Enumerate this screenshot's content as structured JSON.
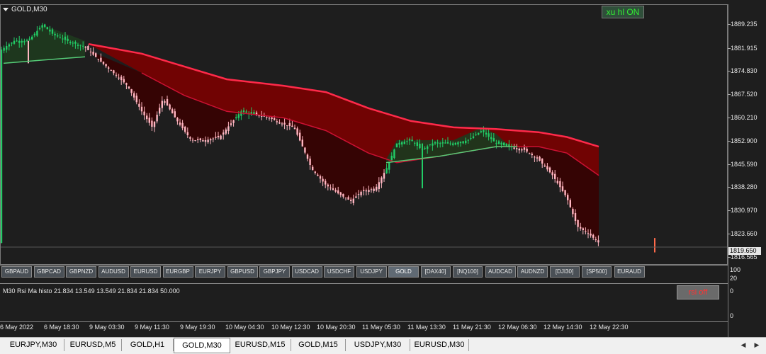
{
  "chart": {
    "title": "GOLD,M30",
    "current_price": "1819.650",
    "price_ticks": [
      "1889.235",
      "1881.915",
      "1874.830",
      "1867.520",
      "1860.210",
      "1852.900",
      "1845.590",
      "1838.280",
      "1830.970",
      "1823.660",
      "1816.565"
    ],
    "time_ticks": [
      "6 May 2022",
      "6 May 18:30",
      "9 May 03:30",
      "9 May 11:30",
      "9 May 19:30",
      "10 May 04:30",
      "10 May 12:30",
      "10 May 20:30",
      "11 May 05:30",
      "11 May 13:30",
      "11 May 21:30",
      "12 May 06:30",
      "12 May 14:30",
      "12 May 22:30"
    ],
    "colors": {
      "bull": "#22cc66",
      "bear": "#ffb6c1",
      "ma_fast": "#ff2a4a",
      "ma_slow": "#cc1133",
      "cloud_bear": "#7a0000",
      "cloud_bull": "#1e3a1e"
    }
  },
  "buttons": {
    "xu_hl": "xu hl ON",
    "rsi": "rsi off"
  },
  "symbols": [
    "GBPAUD",
    "GBPCAD",
    "GBPNZD",
    "AUDUSD",
    "EURUSD",
    "EURGBP",
    "EURJPY",
    "GBPUSD",
    "GBPJPY",
    "USDCAD",
    "USDCHF",
    "USDJPY",
    "GOLD",
    "[DAX40]",
    "[NQ100]",
    "AUDCAD",
    "AUDNZD",
    "[DJI30]",
    "[SP500]",
    "EURAUD"
  ],
  "active_symbol": "GOLD",
  "subwindow_ticks": {
    "first": [
      "100",
      "20"
    ],
    "rsi": [
      "0",
      "0"
    ]
  },
  "rsi_indicator": {
    "label": "M30 Rsi Ma histo 21.834 13.549 13.549 21.834 21.834 50.000"
  },
  "tabs": [
    "EURJPY,M30",
    "EURUSD,M5",
    "GOLD,H1",
    "GOLD,M30",
    "EURUSD,M15",
    "GOLD,M15",
    "USDJPY,M30",
    "EURUSD,M30"
  ],
  "active_tab": "GOLD,M30",
  "icons": {
    "scroll_left": "arrow-left-icon",
    "scroll_right": "arrow-right-icon",
    "chart_menu": "triangle-down-icon"
  }
}
